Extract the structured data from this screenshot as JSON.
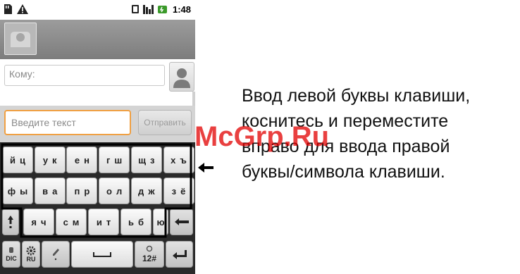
{
  "status_bar": {
    "time": "1:48"
  },
  "compose": {
    "to_placeholder": "Кому:",
    "text_placeholder": "Введите текст",
    "send_label": "Отправить"
  },
  "keyboard": {
    "row1": [
      "й",
      "ц",
      "у",
      "к",
      "е",
      "н",
      "г",
      "ш",
      "щ",
      "з",
      "х",
      "ъ"
    ],
    "row2": [
      "ф",
      "ы",
      "в",
      "а",
      "п",
      "р",
      "о",
      "л",
      "д",
      "ж",
      "з",
      "ё"
    ],
    "row3": [
      "я",
      "ч",
      "с",
      "м",
      "и",
      "т",
      "ь",
      "б",
      "ю"
    ],
    "mic_label": "DIC",
    "settings_label": "RU",
    "symbols_label": "12#"
  },
  "annotation": {
    "lines": [
      "Ввод левой буквы клавиши,",
      "коснитесь и переместите",
      "вправо для ввода правой",
      "буквы/символа клавиши."
    ]
  },
  "watermark": "McGrp.Ru",
  "colors": {
    "input_focus": "#f0a043",
    "title_bar": "#8a8a8a",
    "keyboard_bg": "#2a2a2a"
  }
}
